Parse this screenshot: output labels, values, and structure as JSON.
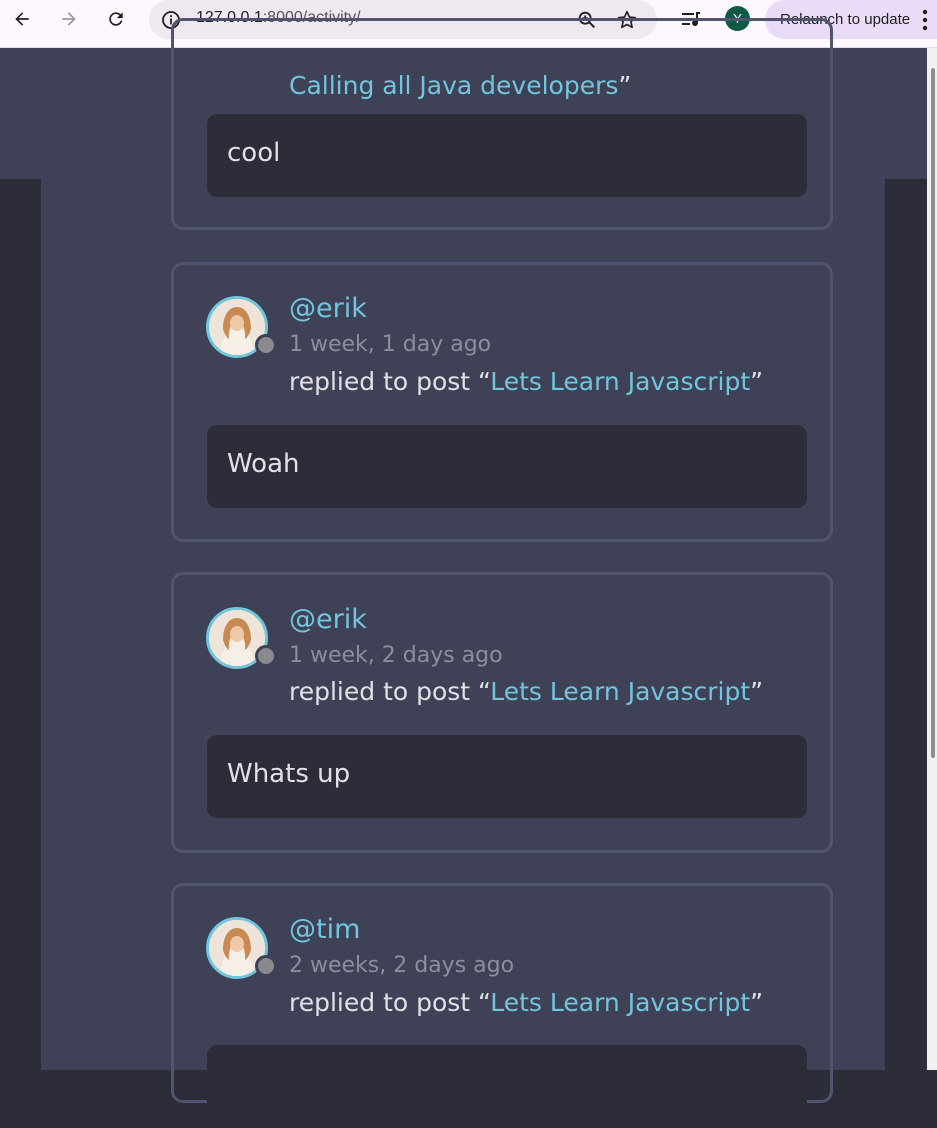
{
  "browser": {
    "url_host": "127.0.0.1",
    "url_rest": ":8000/activity/",
    "profile_initial": "Y",
    "relaunch_label": "Relaunch to update"
  },
  "activities": [
    {
      "action_prefix": "",
      "post_title": "Calling all Java developers",
      "action_suffix": "”",
      "message": "cool"
    },
    {
      "username": "@erik",
      "time": "1 week, 1 day ago",
      "action_prefix": "replied to post “",
      "post_title": "Lets Learn Javascript",
      "action_suffix": "”",
      "message": "Woah"
    },
    {
      "username": "@erik",
      "time": "1 week, 2 days ago",
      "action_prefix": "replied to post “",
      "post_title": "Lets Learn Javascript",
      "action_suffix": "”",
      "message": "Whats up"
    },
    {
      "username": "@tim",
      "time": "2 weeks, 2 days ago",
      "action_prefix": "replied to post “",
      "post_title": "Lets Learn Javascript",
      "action_suffix": "”",
      "message": ""
    }
  ],
  "colors": {
    "accent": "#71c6dd",
    "card_bg": "#3f4156",
    "page_bg": "#2d2d39",
    "card_border": "#51546e"
  }
}
